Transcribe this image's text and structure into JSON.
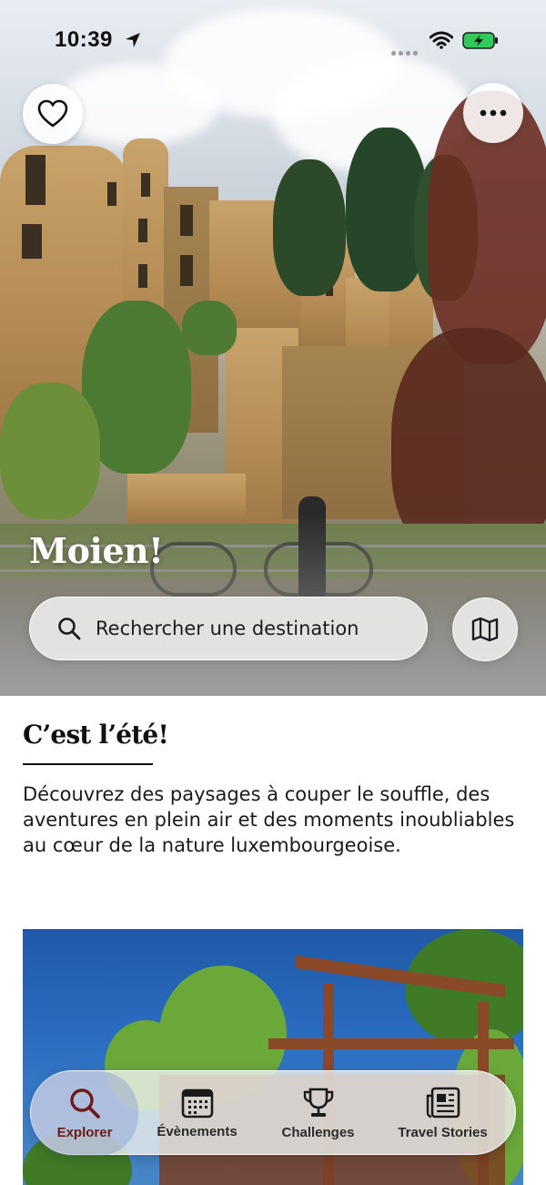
{
  "status_bar": {
    "time": "10:39"
  },
  "hero": {
    "greeting": "Moien!",
    "search": {
      "placeholder": "Rechercher une destination"
    }
  },
  "section": {
    "title": "C’est l’été!",
    "body": "Découvrez des paysages à couper le souffle, des aventures en plein air et des moments inoubliables au cœur de la nature luxembourgeoise."
  },
  "tabs": [
    {
      "label": "Explorer",
      "icon": "search-icon",
      "active": true
    },
    {
      "label": "Évènements",
      "icon": "calendar-icon",
      "active": false
    },
    {
      "label": "Challenges",
      "icon": "trophy-icon",
      "active": false
    },
    {
      "label": "Travel Stories",
      "icon": "newspaper-icon",
      "active": false
    }
  ],
  "colors": {
    "active_tab_label": "#6e1a1a",
    "battery": "#34c759"
  }
}
